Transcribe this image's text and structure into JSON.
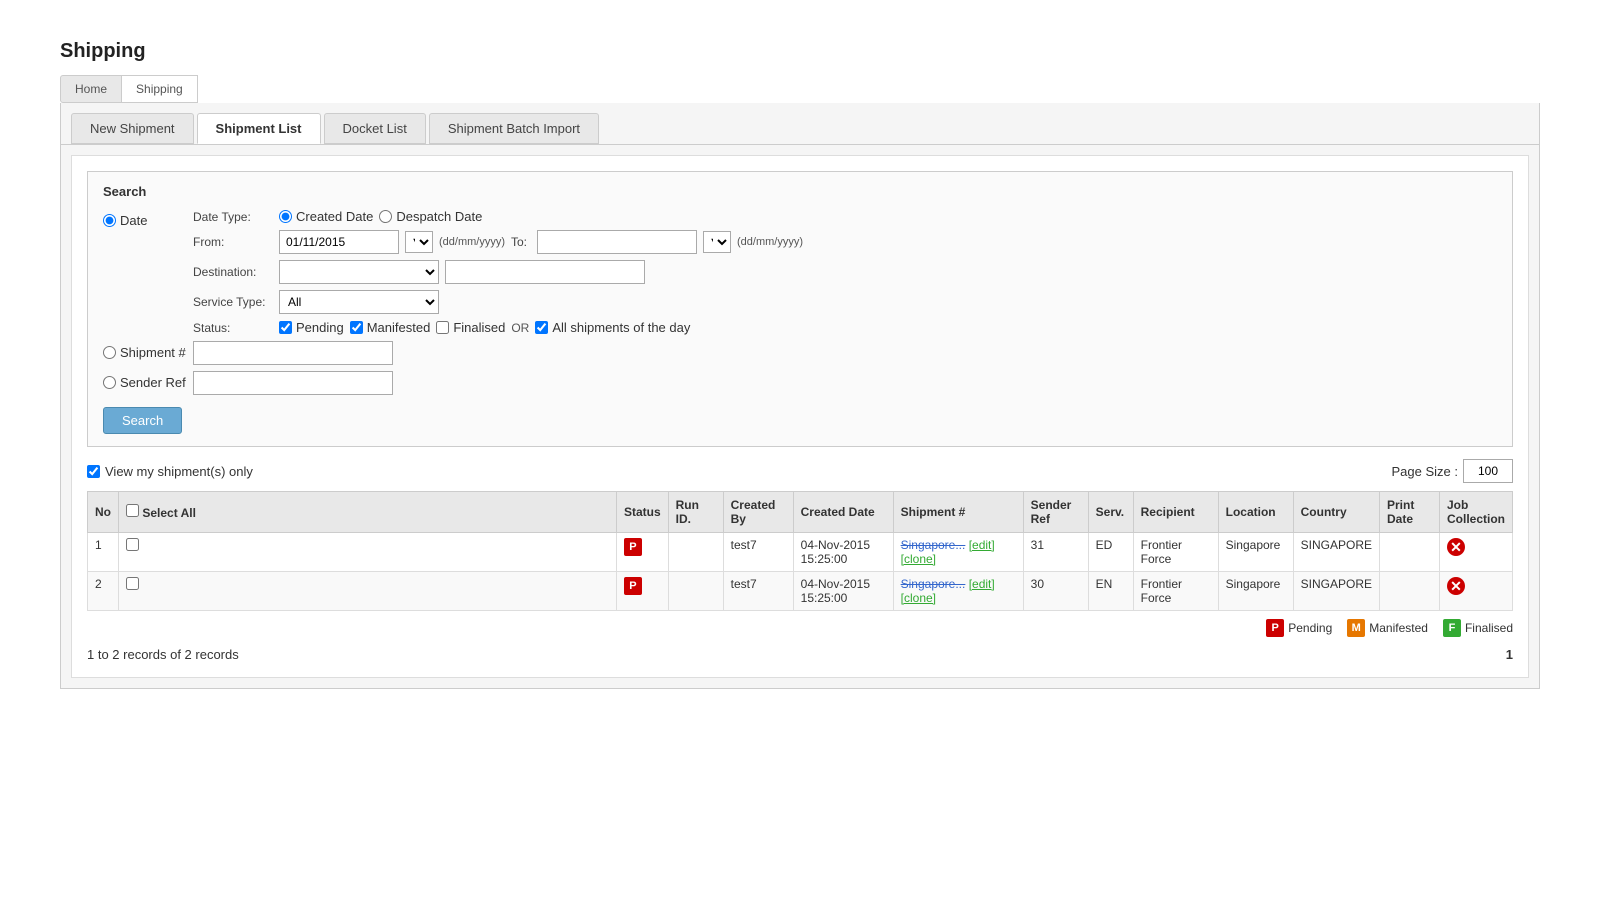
{
  "page": {
    "title": "Shipping",
    "breadcrumbs": [
      "Home",
      "Shipping"
    ]
  },
  "tabs": [
    {
      "id": "new-shipment",
      "label": "New Shipment",
      "active": false
    },
    {
      "id": "shipment-list",
      "label": "Shipment List",
      "active": true
    },
    {
      "id": "docket-list",
      "label": "Docket List",
      "active": false
    },
    {
      "id": "shipment-batch-import",
      "label": "Shipment Batch Import",
      "active": false
    }
  ],
  "search": {
    "title": "Search",
    "date_type_label": "Date Type:",
    "date_type_created": "Created Date",
    "date_type_despatch": "Despatch Date",
    "from_label": "From:",
    "from_value": "01/11/2015",
    "from_placeholder": "dd/mm/yyyy",
    "to_label": "To:",
    "to_placeholder": "",
    "to_format": "(dd/mm/yyyy)",
    "from_format": "(dd/mm/yyyy)",
    "destination_label": "Destination:",
    "service_type_label": "Service Type:",
    "service_type_value": "All",
    "service_type_options": [
      "All"
    ],
    "status_label": "Status:",
    "status_pending": "Pending",
    "status_manifested": "Manifested",
    "status_finalised": "Finalised",
    "status_or": "OR",
    "status_all_day": "All shipments of the day",
    "shipment_num_label": "Shipment #",
    "sender_ref_label": "Sender Ref",
    "search_btn": "Search"
  },
  "options": {
    "view_my_shipments": "View my shipment(s) only",
    "page_size_label": "Page Size :",
    "page_size_value": "100"
  },
  "table": {
    "headers": {
      "no": "No",
      "select_all": "Select All",
      "status": "Status",
      "run_id": "Run ID.",
      "created_by": "Created By",
      "created_date": "Created Date",
      "shipment_num": "Shipment #",
      "sender_ref": "Sender Ref",
      "serv": "Serv.",
      "recipient": "Recipient",
      "location": "Location",
      "country": "Country",
      "print_date": "Print Date",
      "job_collection": "Job Collection"
    },
    "rows": [
      {
        "no": "1",
        "status": "P",
        "run_id": "",
        "created_by": "test7",
        "created_date": "04-Nov-2015 15:25:00",
        "shipment_num_link": "Singapore...",
        "shipment_num_edit": "[edit]",
        "shipment_num_clone": "[clone]",
        "sender_ref": "31",
        "serv": "ED",
        "recipient": "Frontier Force",
        "location": "Singapore",
        "country": "SINGAPORE",
        "print_date": "",
        "job_collection": ""
      },
      {
        "no": "2",
        "status": "P",
        "run_id": "",
        "created_by": "test7",
        "created_date": "04-Nov-2015 15:25:00",
        "shipment_num_link": "Singapore...",
        "shipment_num_edit": "[edit]",
        "shipment_num_clone": "[clone]",
        "sender_ref": "30",
        "serv": "EN",
        "recipient": "Frontier Force",
        "location": "Singapore",
        "country": "SINGAPORE",
        "print_date": "",
        "job_collection": ""
      }
    ]
  },
  "legend": {
    "pending_label": "Pending",
    "manifested_label": "Manifested",
    "finalised_label": "Finalised"
  },
  "pagination": {
    "records_text": "1 to 2 records of 2 records",
    "page_number": "1"
  }
}
